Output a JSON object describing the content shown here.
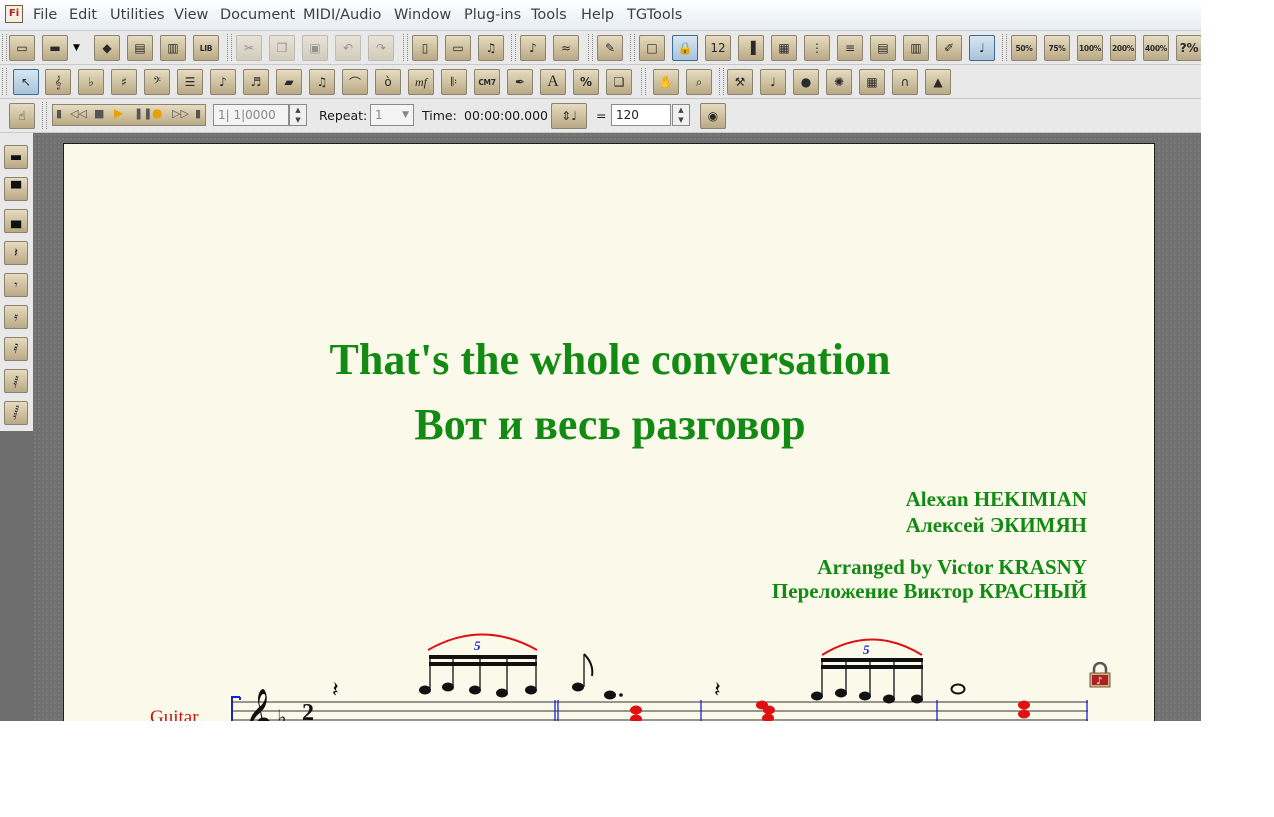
{
  "app": {
    "icon_label": "Fi"
  },
  "menubar": {
    "items": [
      "File",
      "Edit",
      "Utilities",
      "View",
      "Document",
      "MIDI/Audio",
      "Window",
      "Plug-ins",
      "Tools",
      "Help",
      "TGTools"
    ]
  },
  "toolbar1": {
    "zoom_labels": [
      "50%",
      "75%",
      "100%",
      "200%",
      "400%",
      "?%"
    ],
    "library_label": "LIB"
  },
  "toolbar2": {
    "chord_label": "CM7",
    "dynamic_label": "mf",
    "text_label": "A",
    "percent_label": "%"
  },
  "playback": {
    "counter": "1| 1|0000",
    "repeat_label": "Repeat:",
    "repeat_value": "1",
    "time_label": "Time:",
    "time_value": "00:00:00.000",
    "equals": "=",
    "tempo": "120"
  },
  "document": {
    "title_en": "That's the whole conversation",
    "title_ru": "Вот и весь разговор",
    "composer_en": "Alexan HEKIMIAN",
    "composer_ru": "Алексей ЭКИМЯН",
    "arranger_en": "Arranged by Victor KRASNY",
    "arranger_ru": "Переложение Виктор КРАСНЫЙ",
    "staff_label": "Guitar",
    "tuplet_number": "5",
    "time_signature_top": "2"
  },
  "colors": {
    "title": "#138a13",
    "staff_label": "#d01010",
    "selected_notes": "#e01010",
    "tuplet": "#1a22c8"
  }
}
